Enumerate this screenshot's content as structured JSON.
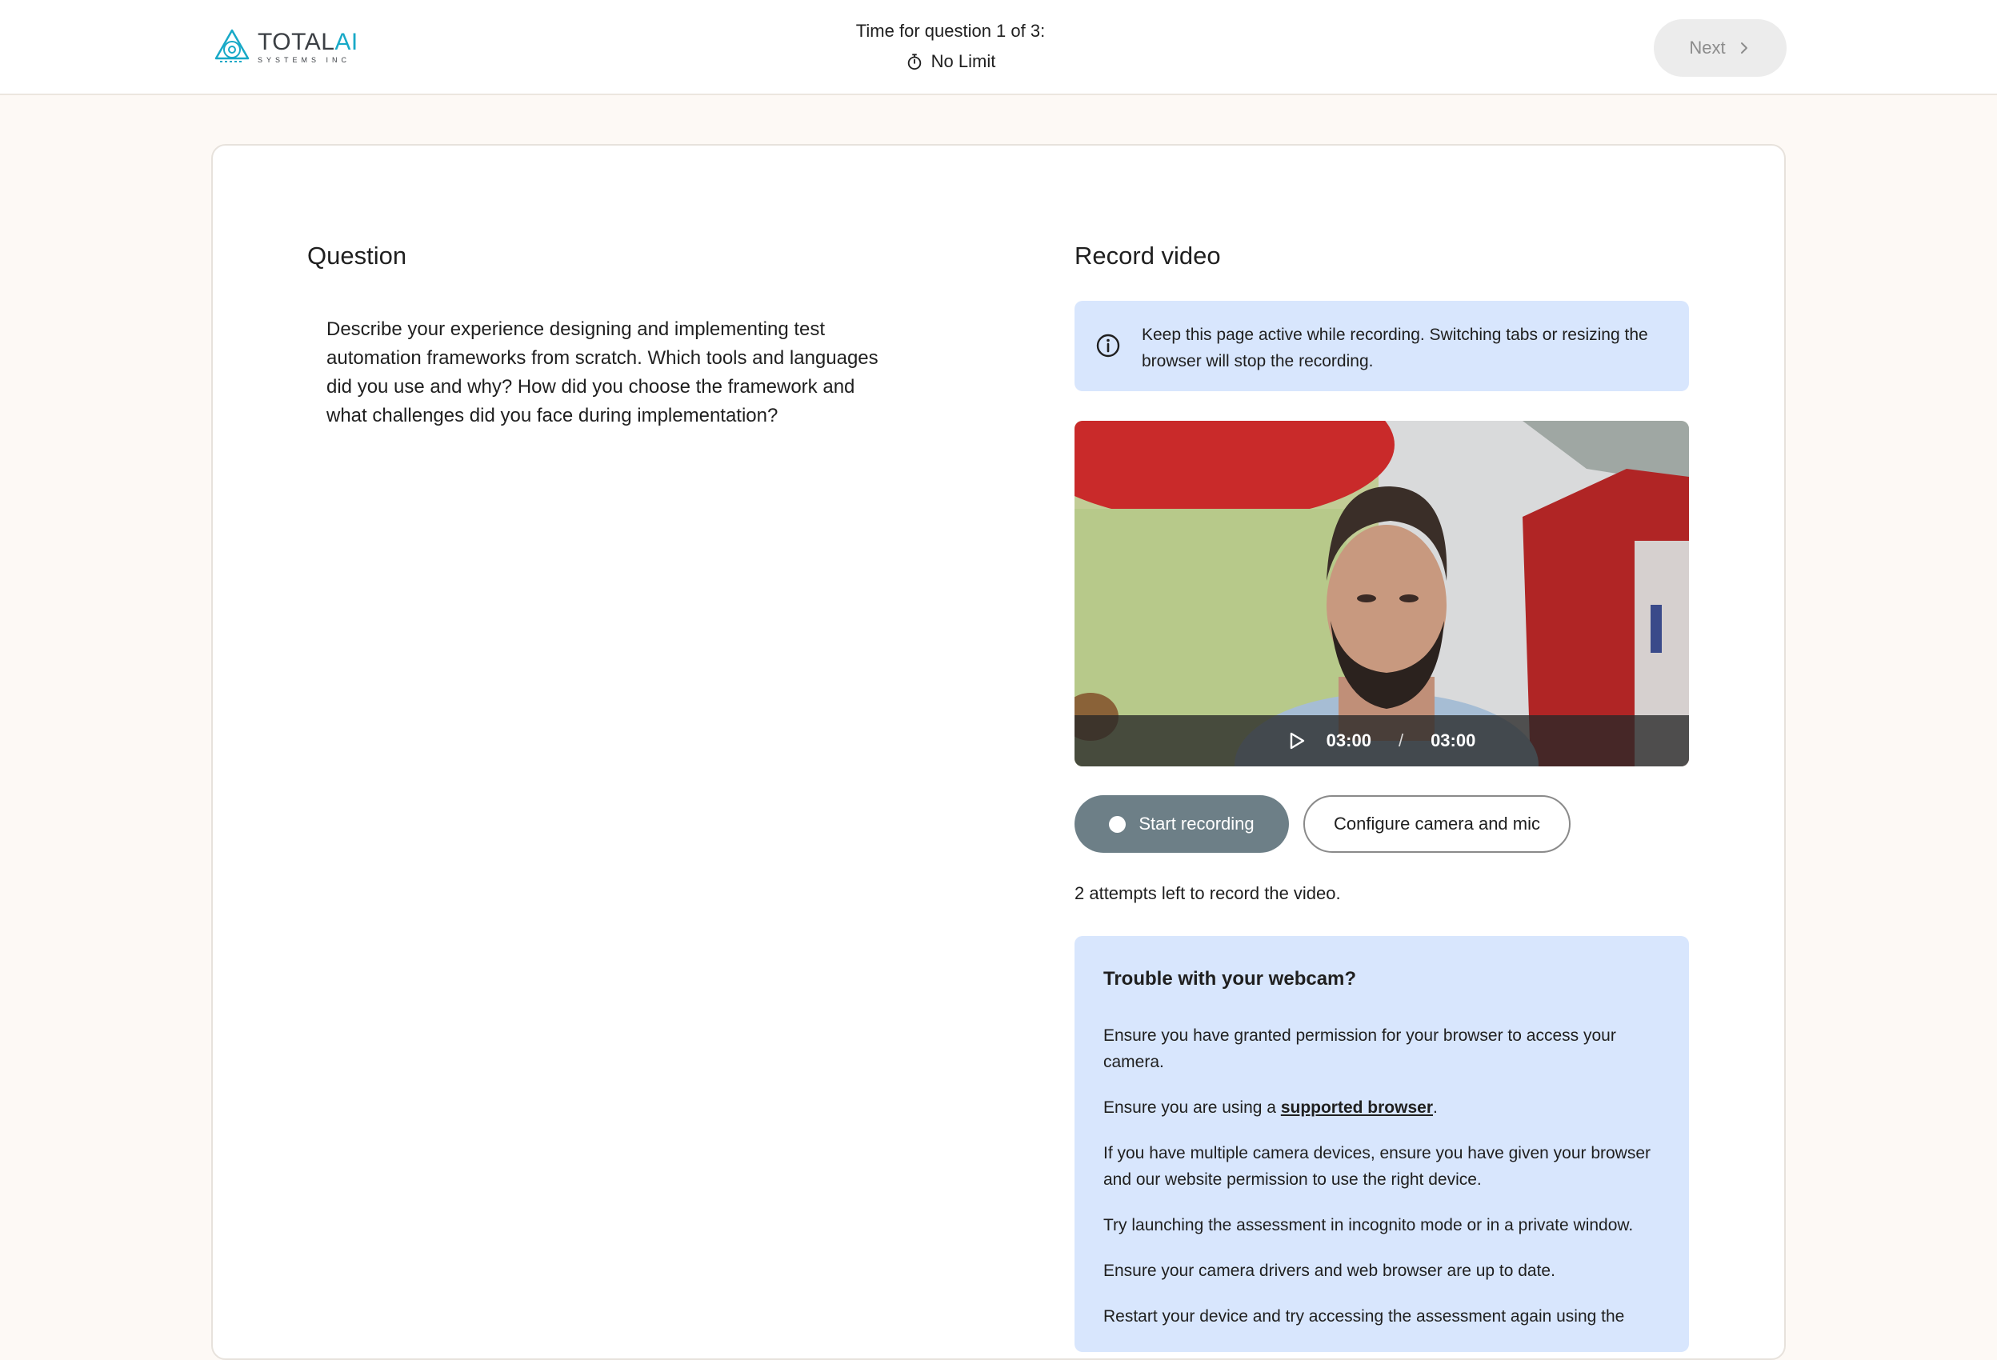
{
  "header": {
    "logo": {
      "name_main": "TOTAL",
      "name_accent": "AI",
      "subtitle": "SYSTEMS INC"
    },
    "timer": {
      "title": "Time for question 1 of 3:",
      "value": "No Limit",
      "icon": "stopwatch-icon"
    },
    "next_label": "Next",
    "next_icon": "chevron-right-icon"
  },
  "question": {
    "heading": "Question",
    "text": "Describe your experience designing and implementing test automation frameworks from scratch. Which tools and languages did you use and why? How did you choose the framework and what challenges did you face during implementation?"
  },
  "recorder": {
    "heading": "Record video",
    "info_icon": "info-icon",
    "info_text": "Keep this page active while recording. Switching tabs or resizing the browser will stop the recording.",
    "video": {
      "current_time": "03:00",
      "separator": "/",
      "duration": "03:00",
      "play_icon": "play-icon"
    },
    "start_label": "Start recording",
    "configure_label": "Configure camera and mic",
    "attempts_text": "2 attempts left to record the video."
  },
  "trouble": {
    "title": "Trouble with your webcam?",
    "tip1": "Ensure you have granted permission for your browser to access your camera.",
    "tip2_before": "Ensure you are using a ",
    "tip2_link": "supported browser",
    "tip2_after": ".",
    "tip3": "If you have multiple camera devices, ensure you have given your browser and our website permission to use the right device.",
    "tip4": "Try launching the assessment in incognito mode or in a private window.",
    "tip5": "Ensure your camera drivers and web browser are up to date.",
    "tip6": "Restart your device and try accessing the assessment again using the"
  },
  "colors": {
    "accent": "#18a9c7",
    "info_bg": "#d8e6fd",
    "record_button": "#6d7f87",
    "page_bg": "#fdf9f5"
  }
}
